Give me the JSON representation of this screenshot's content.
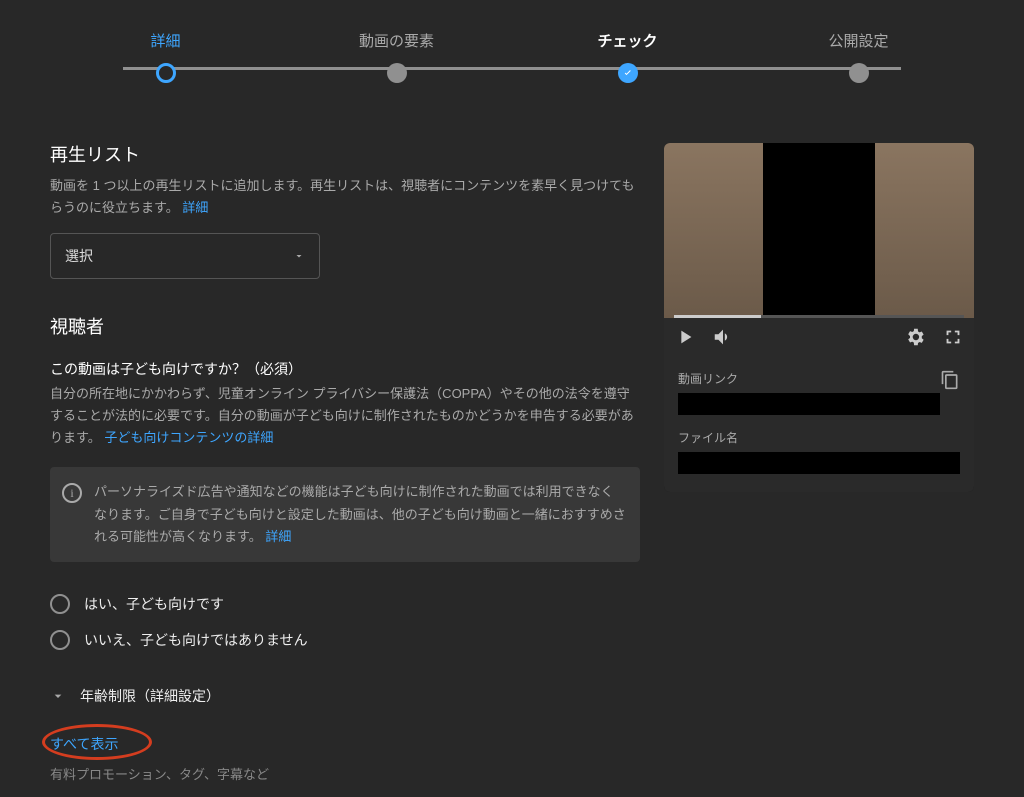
{
  "stepper": {
    "steps": [
      {
        "label": "詳細",
        "state": "done"
      },
      {
        "label": "動画の要素",
        "state": "pending"
      },
      {
        "label": "チェック",
        "state": "active"
      },
      {
        "label": "公開設定",
        "state": "pending"
      }
    ]
  },
  "playlist": {
    "title": "再生リスト",
    "desc": "動画を 1 つ以上の再生リストに追加します。再生リストは、視聴者にコンテンツを素早く見つけてもらうのに役立ちます。",
    "learnMore": "詳細",
    "select": "選択"
  },
  "audience": {
    "title": "視聴者",
    "question": "この動画は子ども向けですか？（必須）",
    "desc": "自分の所在地にかかわらず、児童オンライン プライバシー保護法（COPPA）やその他の法令を遵守することが法的に必要です。自分の動画が子ども向けに制作されたものかどうかを申告する必要があります。",
    "learnMore": "子ども向けコンテンツの詳細",
    "info": "パーソナライズド広告や通知などの機能は子ども向けに制作された動画では利用できなくなります。ご自身で子ども向けと設定した動画は、他の子ども向け動画と一緒におすすめされる可能性が高くなります。",
    "infoLink": "詳細",
    "radioYes": "はい、子ども向けです",
    "radioNo": "いいえ、子ども向けではありません",
    "ageRestriction": "年齢制限（詳細設定）"
  },
  "showAll": {
    "label": "すべて表示",
    "note": "有料プロモーション、タグ、字幕など"
  },
  "preview": {
    "videoLinkLabel": "動画リンク",
    "fileNameLabel": "ファイル名"
  }
}
